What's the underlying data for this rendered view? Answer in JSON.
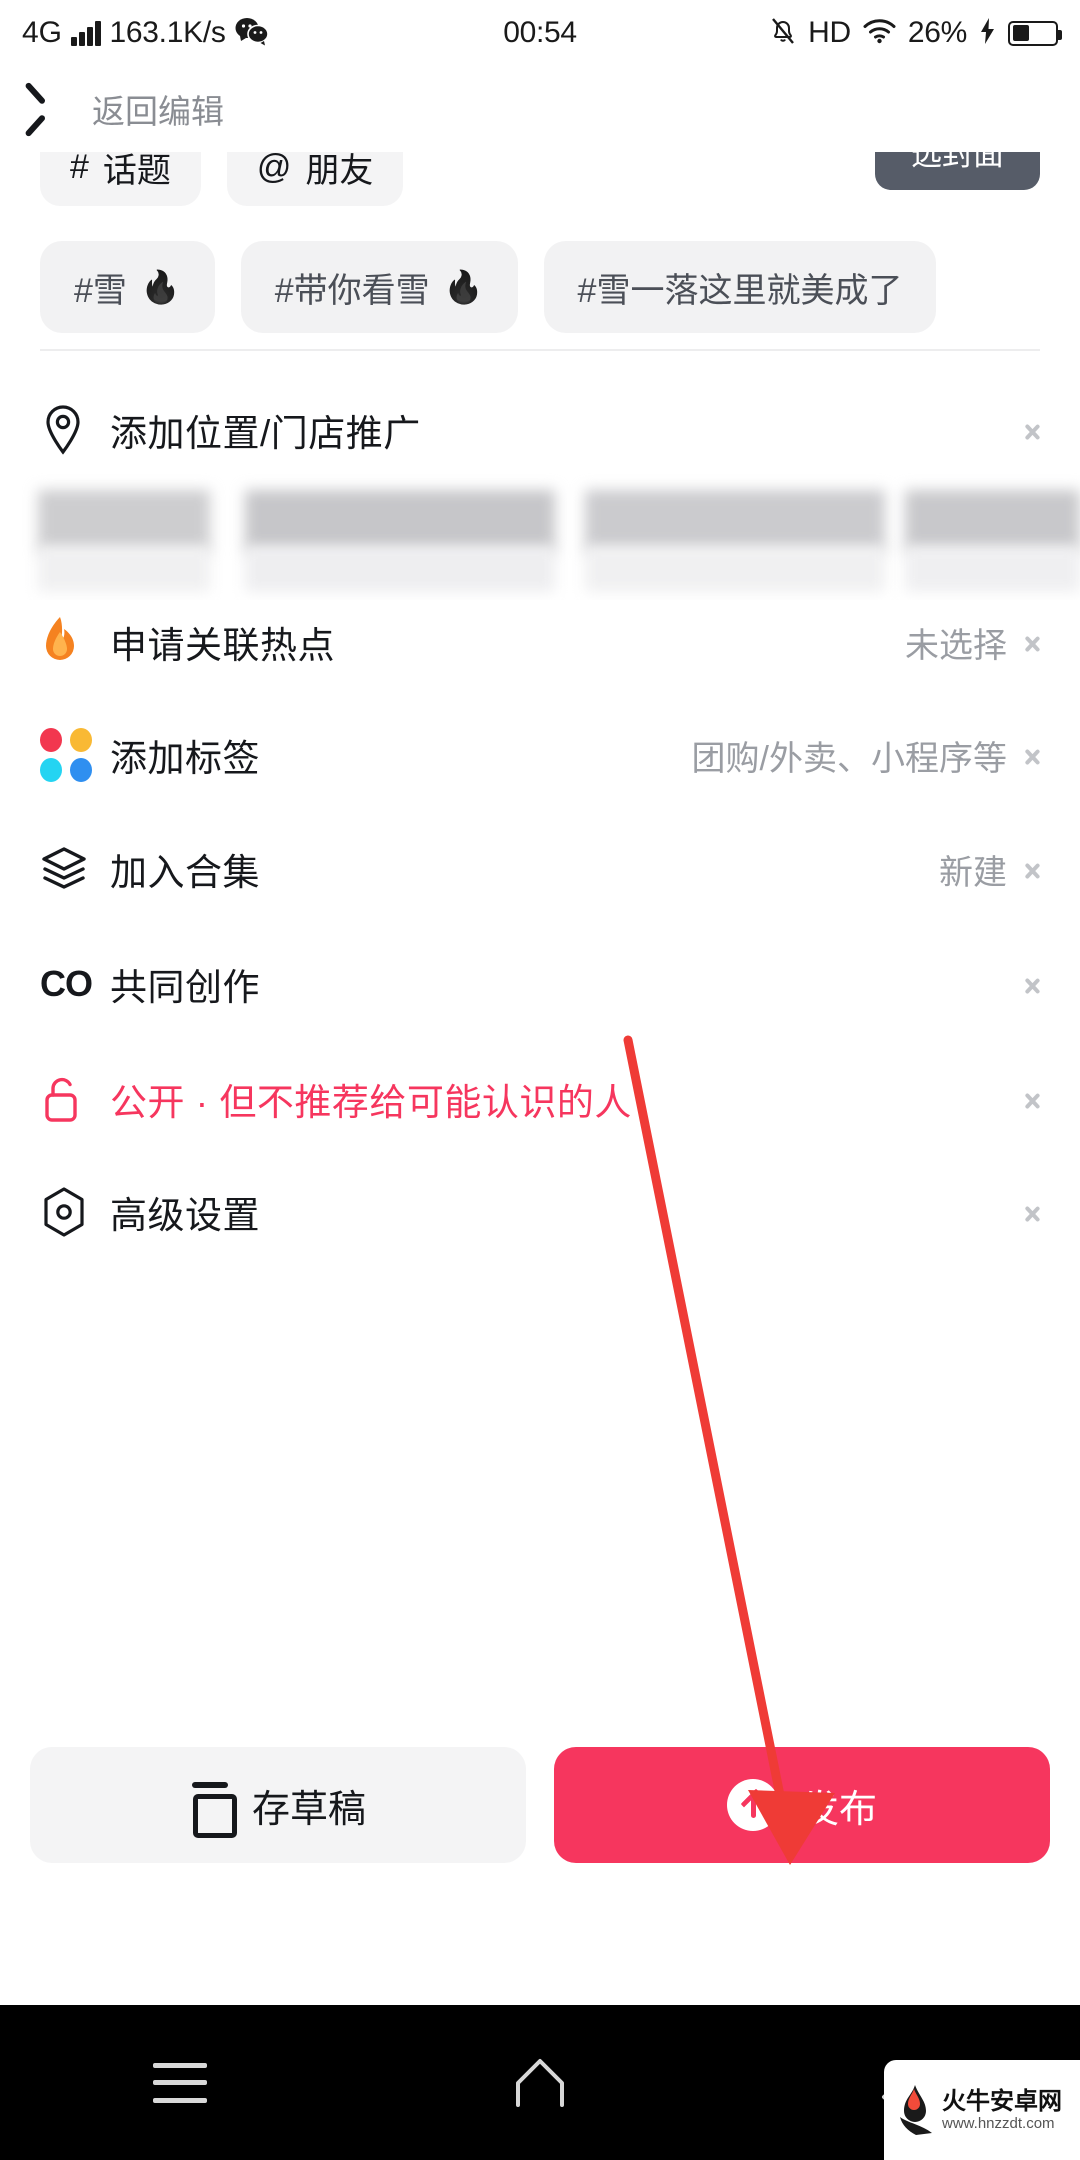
{
  "status_bar": {
    "network_type": "4G",
    "signal_icon": "signal-bars-icon",
    "speed": "163.1K/s",
    "wechat_icon": "wechat-icon",
    "time": "00:54",
    "mute_icon": "bell-mute-icon",
    "hd": "HD",
    "wifi_icon": "wifi-icon",
    "battery_percent": "26%",
    "charging_icon": "charging-bolt-icon",
    "battery_icon": "battery-icon"
  },
  "header": {
    "back_icon": "chevron-left-icon",
    "title": "返回编辑"
  },
  "toolbar": {
    "topic_chip": "话题",
    "topic_prefix": "#",
    "friend_chip": "朋友",
    "friend_prefix": "@",
    "cover_button": "选封面"
  },
  "suggested_tags": [
    {
      "label": "#雪",
      "flame": "🔥"
    },
    {
      "label": "#带你看雪",
      "flame": "🔥"
    },
    {
      "label": "#雪一落这里就美成了",
      "flame": ""
    }
  ],
  "location_row": {
    "icon": "location-pin-icon",
    "label": "添加位置/门店推广",
    "chevron": "chevron-right-icon"
  },
  "blurred_location_chips": "blurred-location-suggestions",
  "settings_rows": [
    {
      "icon": "flame-icon",
      "label": "申请关联热点",
      "value": "未选择",
      "chevron": "chevron-right-icon"
    },
    {
      "icon": "four-dots-icon",
      "label": "添加标签",
      "value": "团购/外卖、小程序等",
      "chevron": "chevron-right-icon"
    },
    {
      "icon": "layers-icon",
      "label": "加入合集",
      "value": "新建",
      "chevron": "chevron-right-icon"
    },
    {
      "icon": "co-create-icon",
      "label": "共同创作",
      "value": "",
      "chevron": "chevron-right-icon"
    },
    {
      "icon": "unlock-icon",
      "label": "公开 · 但不推荐给可能认识的人",
      "value": "",
      "chevron": "chevron-right-icon"
    },
    {
      "icon": "hexagon-settings-icon",
      "label": "高级设置",
      "value": "",
      "chevron": "chevron-right-icon"
    }
  ],
  "bottom_bar": {
    "draft_icon": "save-draft-icon",
    "draft_label": "存草稿",
    "publish_icon": "upload-arrow-icon",
    "publish_label": "发布"
  },
  "android_nav": {
    "recent_icon": "recent-apps-icon",
    "home_icon": "home-icon",
    "back_icon": "back-icon"
  },
  "watermark": {
    "name": "火牛安卓网",
    "url": "www.hnzzdt.com"
  },
  "colors": {
    "accent_red": "#f6365e",
    "privacy_red": "#f6365e",
    "chip_bg": "#f2f2f3",
    "cover_btn_bg": "#565c68",
    "muted_text": "#9a9da3",
    "annotation_arrow": "#ef3b36"
  }
}
